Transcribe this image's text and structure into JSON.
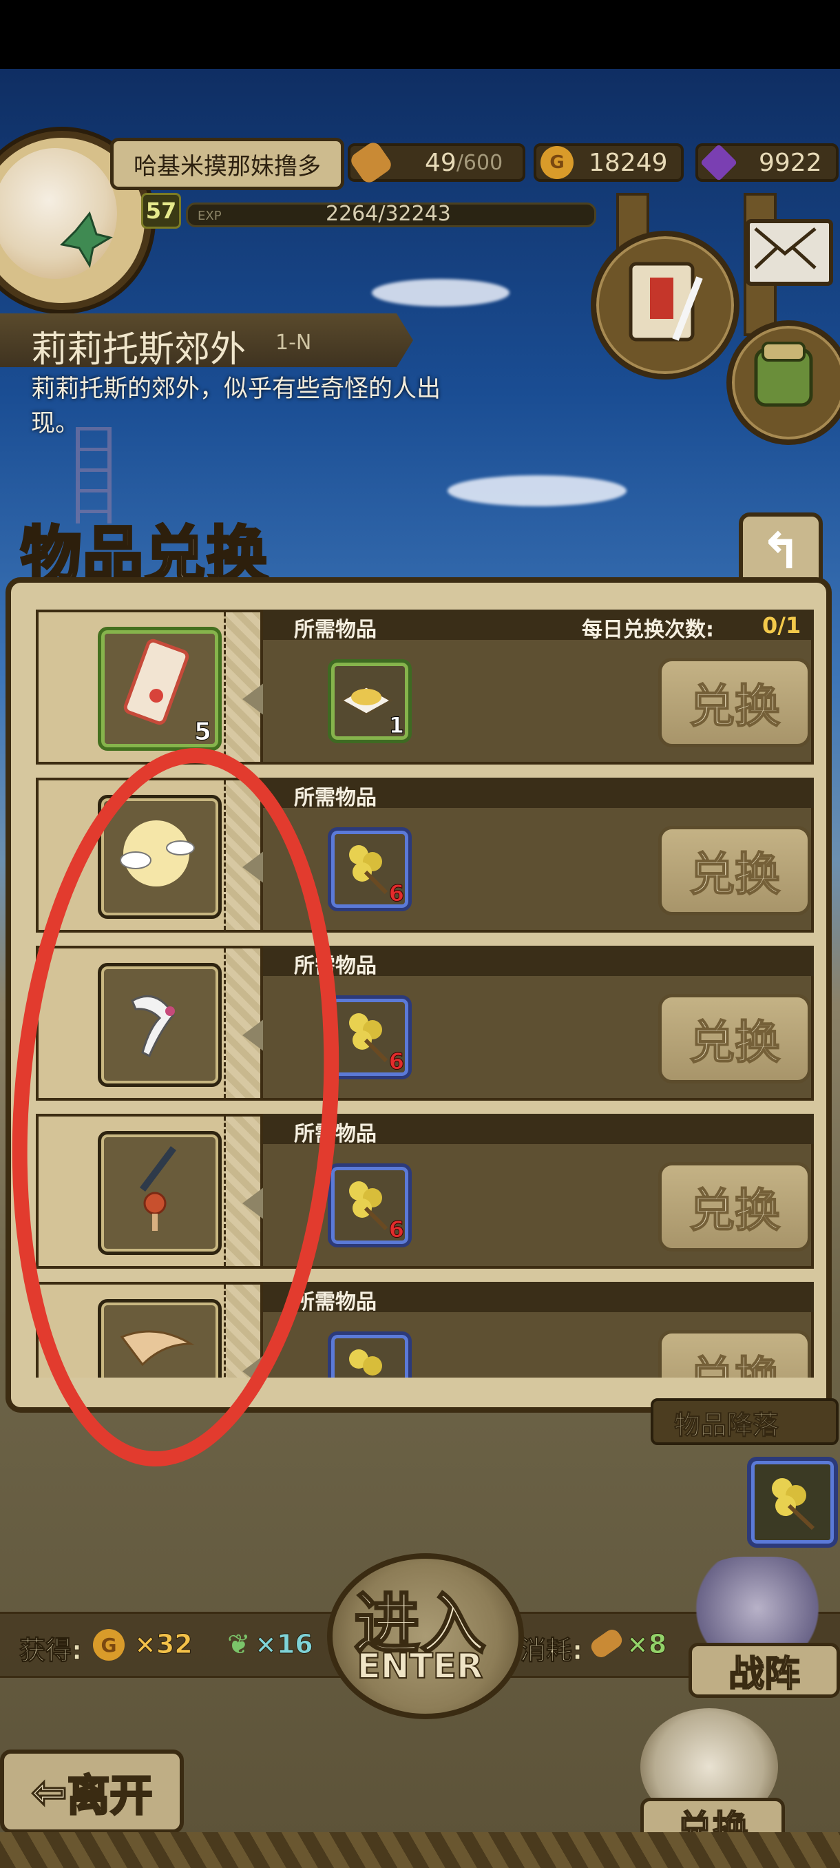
{
  "header": {
    "player_name": "哈基米摸那妹撸多",
    "stamina": "49",
    "stamina_max": "/600",
    "gold": "18249",
    "gems": "9922",
    "level": "57",
    "exp_label": "EXP",
    "exp": "2264/32243"
  },
  "location": {
    "title": "莉莉托斯郊外",
    "code": "1-N",
    "description": "莉莉托斯的郊外，似乎有些奇怪的人出现。"
  },
  "panel": {
    "title": "物品兑换",
    "back_icon": "return-arrow-icon",
    "rows": [
      {
        "item_icon": "talisman-card-icon",
        "count": "5",
        "header": "所需物品",
        "daily_label": "每日兑换次数:",
        "daily_value": "0/1",
        "req_icon": "yellow-powder-icon",
        "req_count": "1",
        "button": "兑换"
      },
      {
        "item_icon": "moon-clouds-icon",
        "count": "",
        "header": "所需物品",
        "req_icon": "flower-bundle-icon",
        "req_count": "6",
        "button": "兑换"
      },
      {
        "item_icon": "white-ribbon-icon",
        "count": "",
        "header": "所需物品",
        "req_icon": "flower-bundle-icon",
        "req_count": "6",
        "button": "兑换"
      },
      {
        "item_icon": "flute-tassel-icon",
        "count": "",
        "header": "所需物品",
        "req_icon": "flower-bundle-icon",
        "req_count": "6",
        "button": "兑换"
      },
      {
        "item_icon": "sash-ribbon-icon",
        "count": "",
        "header": "所需物品",
        "req_icon": "flower-bundle-icon",
        "req_count": "",
        "button": "兑换"
      }
    ]
  },
  "bottom": {
    "gain_label": "获得:",
    "gain_gold": "×32",
    "gain_feather": "×16",
    "cost_label": "消耗:",
    "cost_stamina": "×8",
    "enter_cn": "进入",
    "enter_en": "ENTER",
    "formation": "战阵",
    "exchange": "兑换",
    "leave": "离开",
    "partial_label": "物品降落"
  },
  "colors": {
    "annotation_circle": "#e23b2e",
    "daily_value": "#f3c94b",
    "required_count": "#e32c2c"
  }
}
